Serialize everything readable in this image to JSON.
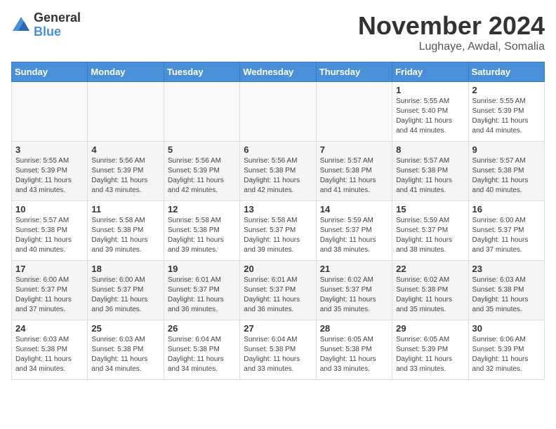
{
  "logo": {
    "general": "General",
    "blue": "Blue"
  },
  "title": "November 2024",
  "location": "Lughaye, Awdal, Somalia",
  "days_header": [
    "Sunday",
    "Monday",
    "Tuesday",
    "Wednesday",
    "Thursday",
    "Friday",
    "Saturday"
  ],
  "weeks": [
    [
      {
        "day": "",
        "info": ""
      },
      {
        "day": "",
        "info": ""
      },
      {
        "day": "",
        "info": ""
      },
      {
        "day": "",
        "info": ""
      },
      {
        "day": "",
        "info": ""
      },
      {
        "day": "1",
        "info": "Sunrise: 5:55 AM\nSunset: 5:40 PM\nDaylight: 11 hours\nand 44 minutes."
      },
      {
        "day": "2",
        "info": "Sunrise: 5:55 AM\nSunset: 5:39 PM\nDaylight: 11 hours\nand 44 minutes."
      }
    ],
    [
      {
        "day": "3",
        "info": "Sunrise: 5:55 AM\nSunset: 5:39 PM\nDaylight: 11 hours\nand 43 minutes."
      },
      {
        "day": "4",
        "info": "Sunrise: 5:56 AM\nSunset: 5:39 PM\nDaylight: 11 hours\nand 43 minutes."
      },
      {
        "day": "5",
        "info": "Sunrise: 5:56 AM\nSunset: 5:39 PM\nDaylight: 11 hours\nand 42 minutes."
      },
      {
        "day": "6",
        "info": "Sunrise: 5:56 AM\nSunset: 5:38 PM\nDaylight: 11 hours\nand 42 minutes."
      },
      {
        "day": "7",
        "info": "Sunrise: 5:57 AM\nSunset: 5:38 PM\nDaylight: 11 hours\nand 41 minutes."
      },
      {
        "day": "8",
        "info": "Sunrise: 5:57 AM\nSunset: 5:38 PM\nDaylight: 11 hours\nand 41 minutes."
      },
      {
        "day": "9",
        "info": "Sunrise: 5:57 AM\nSunset: 5:38 PM\nDaylight: 11 hours\nand 40 minutes."
      }
    ],
    [
      {
        "day": "10",
        "info": "Sunrise: 5:57 AM\nSunset: 5:38 PM\nDaylight: 11 hours\nand 40 minutes."
      },
      {
        "day": "11",
        "info": "Sunrise: 5:58 AM\nSunset: 5:38 PM\nDaylight: 11 hours\nand 39 minutes."
      },
      {
        "day": "12",
        "info": "Sunrise: 5:58 AM\nSunset: 5:38 PM\nDaylight: 11 hours\nand 39 minutes."
      },
      {
        "day": "13",
        "info": "Sunrise: 5:58 AM\nSunset: 5:37 PM\nDaylight: 11 hours\nand 39 minutes."
      },
      {
        "day": "14",
        "info": "Sunrise: 5:59 AM\nSunset: 5:37 PM\nDaylight: 11 hours\nand 38 minutes."
      },
      {
        "day": "15",
        "info": "Sunrise: 5:59 AM\nSunset: 5:37 PM\nDaylight: 11 hours\nand 38 minutes."
      },
      {
        "day": "16",
        "info": "Sunrise: 6:00 AM\nSunset: 5:37 PM\nDaylight: 11 hours\nand 37 minutes."
      }
    ],
    [
      {
        "day": "17",
        "info": "Sunrise: 6:00 AM\nSunset: 5:37 PM\nDaylight: 11 hours\nand 37 minutes."
      },
      {
        "day": "18",
        "info": "Sunrise: 6:00 AM\nSunset: 5:37 PM\nDaylight: 11 hours\nand 36 minutes."
      },
      {
        "day": "19",
        "info": "Sunrise: 6:01 AM\nSunset: 5:37 PM\nDaylight: 11 hours\nand 36 minutes."
      },
      {
        "day": "20",
        "info": "Sunrise: 6:01 AM\nSunset: 5:37 PM\nDaylight: 11 hours\nand 36 minutes."
      },
      {
        "day": "21",
        "info": "Sunrise: 6:02 AM\nSunset: 5:37 PM\nDaylight: 11 hours\nand 35 minutes."
      },
      {
        "day": "22",
        "info": "Sunrise: 6:02 AM\nSunset: 5:38 PM\nDaylight: 11 hours\nand 35 minutes."
      },
      {
        "day": "23",
        "info": "Sunrise: 6:03 AM\nSunset: 5:38 PM\nDaylight: 11 hours\nand 35 minutes."
      }
    ],
    [
      {
        "day": "24",
        "info": "Sunrise: 6:03 AM\nSunset: 5:38 PM\nDaylight: 11 hours\nand 34 minutes."
      },
      {
        "day": "25",
        "info": "Sunrise: 6:03 AM\nSunset: 5:38 PM\nDaylight: 11 hours\nand 34 minutes."
      },
      {
        "day": "26",
        "info": "Sunrise: 6:04 AM\nSunset: 5:38 PM\nDaylight: 11 hours\nand 34 minutes."
      },
      {
        "day": "27",
        "info": "Sunrise: 6:04 AM\nSunset: 5:38 PM\nDaylight: 11 hours\nand 33 minutes."
      },
      {
        "day": "28",
        "info": "Sunrise: 6:05 AM\nSunset: 5:38 PM\nDaylight: 11 hours\nand 33 minutes."
      },
      {
        "day": "29",
        "info": "Sunrise: 6:05 AM\nSunset: 5:39 PM\nDaylight: 11 hours\nand 33 minutes."
      },
      {
        "day": "30",
        "info": "Sunrise: 6:06 AM\nSunset: 5:39 PM\nDaylight: 11 hours\nand 32 minutes."
      }
    ]
  ]
}
